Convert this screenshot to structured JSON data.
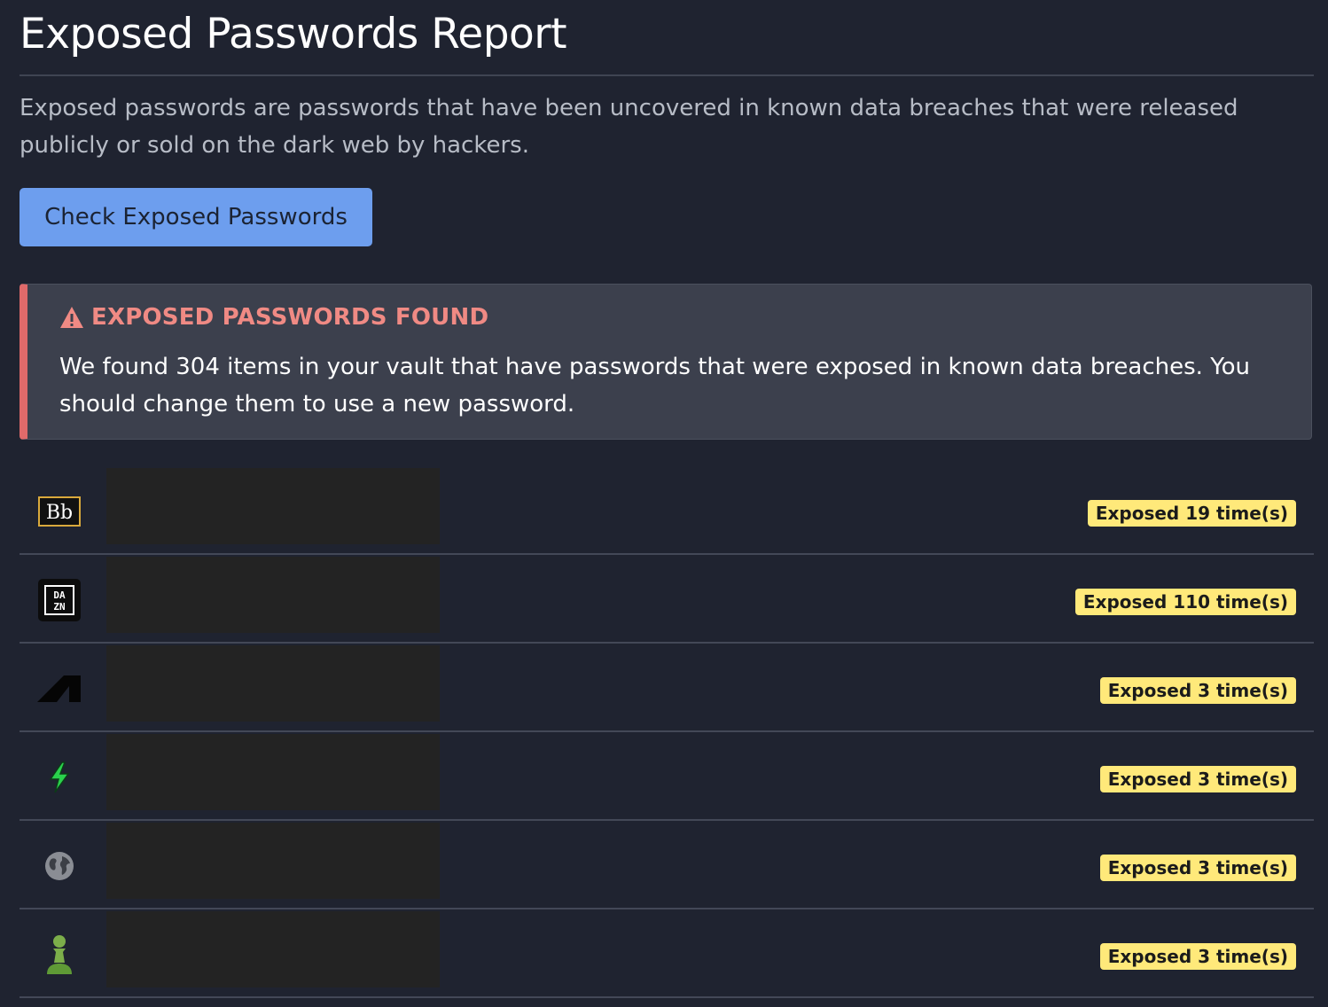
{
  "report": {
    "title": "Exposed Passwords Report",
    "description": "Exposed passwords are passwords that have been uncovered in known data breaches that were released publicly or sold on the dark web by hackers.",
    "check_button_label": "Check Exposed Passwords"
  },
  "alert": {
    "icon": "warning-icon",
    "heading": "EXPOSED PASSWORDS FOUND",
    "body": "We found 304 items in your vault that have passwords that were exposed in known data breaches. You should change them to use a new password.",
    "color": "#e06a6a"
  },
  "items": [
    {
      "icon": "blackboard-icon",
      "exposed_label": "Exposed 19 time(s)"
    },
    {
      "icon": "dazn-icon",
      "exposed_label": "Exposed 110 time(s)"
    },
    {
      "icon": "autodesk-icon",
      "exposed_label": "Exposed 3 time(s)"
    },
    {
      "icon": "lightning-bolt-icon",
      "exposed_label": "Exposed 3 time(s)"
    },
    {
      "icon": "globe-icon",
      "exposed_label": "Exposed 3 time(s)"
    },
    {
      "icon": "chess-pawn-icon",
      "exposed_label": "Exposed 3 time(s)"
    }
  ],
  "colors": {
    "background": "#1f2330",
    "button": "#6d9eee",
    "badge": "#ffe97a",
    "alert_accent": "#e06a6a"
  }
}
